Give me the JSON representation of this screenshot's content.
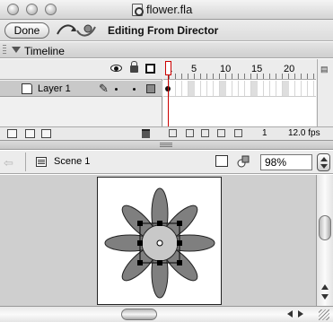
{
  "window": {
    "title": "flower.fla"
  },
  "director_bar": {
    "done_label": "Done",
    "editing_label": "Editing From Director"
  },
  "timeline": {
    "panel_title": "Timeline",
    "layers": [
      {
        "name": "Layer 1"
      }
    ],
    "frame_numbers": [
      "1",
      "5",
      "10",
      "15",
      "20"
    ],
    "current_frame": "1",
    "frame_rate": "12.0 fps"
  },
  "edit_bar": {
    "scene_label": "Scene 1",
    "zoom": "98%"
  },
  "colors": {
    "petal_fill": "#7f7f7f",
    "center_fill": "#c8c8c8",
    "selection_handles": "#000000"
  }
}
